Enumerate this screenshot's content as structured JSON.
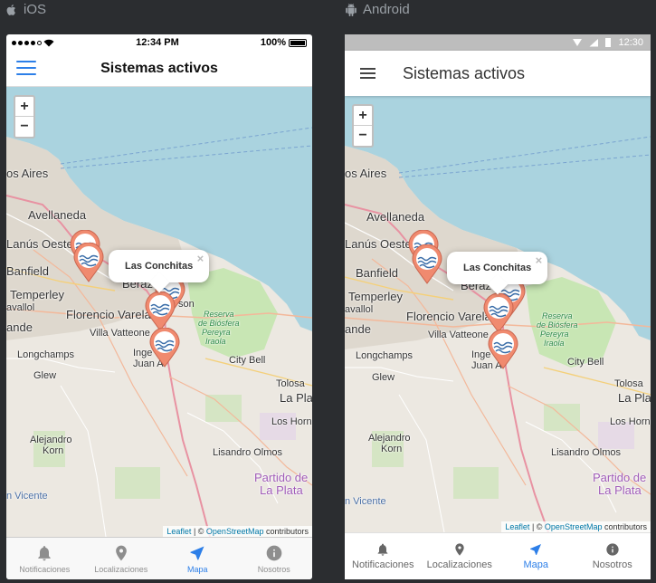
{
  "platforms": {
    "ios": "iOS",
    "android": "Android"
  },
  "ios_status": {
    "time": "12:34 PM",
    "battery": "100%"
  },
  "android_status": {
    "time": "12:30"
  },
  "header": {
    "title": "Sistemas activos"
  },
  "map": {
    "zoom_in": "+",
    "zoom_out": "−",
    "popup_title": "Las Conchitas",
    "popup_close": "×",
    "attribution": {
      "leaflet": "Leaflet",
      "separator": " | © ",
      "osm": "OpenStreetMap",
      "suffix": " contributors"
    },
    "places": {
      "buenos_aires": "os Aires",
      "avellaneda": "Avellaneda",
      "lanus": "Lanús Oeste",
      "banfield": "Banfield",
      "temperley": "Temperley",
      "berazategui": "Beraza",
      "son": "son",
      "avallol": "avallol",
      "florencio": "Florencio Varela",
      "ande": "ande",
      "villa_vatteone": "Villa Vatteone",
      "longchamps": "Longchamps",
      "ingeniero": "Inge",
      "juan_a": "Juan A",
      "glew": "Glew",
      "city_bell": "City Bell",
      "tolosa": "Tolosa",
      "la_plata": "La Plata",
      "los_hornos": "Los Hornos",
      "alejandro_korn_1": "Alejandro",
      "alejandro_korn_2": "Korn",
      "lisandro_olmos": "Lisandro Olmos",
      "partido_1": "Partido de",
      "partido_2": "La Plata",
      "san_vicente": "n Vicente",
      "reserva_1": "Reserva",
      "reserva_2": "de Biósfera",
      "reserva_3": "Pereyra",
      "reserva_4": "Iraola"
    }
  },
  "tabs": [
    {
      "label": "Notificaciones",
      "icon": "bell-icon"
    },
    {
      "label": "Localizaciones",
      "icon": "location-pin-icon"
    },
    {
      "label": "Mapa",
      "icon": "navigation-arrow-icon"
    },
    {
      "label": "Nosotros",
      "icon": "info-icon"
    }
  ],
  "colors": {
    "accent": "#2d7fe8",
    "water": "#aad3df",
    "marker": "#f08a6f",
    "park": "#c8e6b4"
  }
}
